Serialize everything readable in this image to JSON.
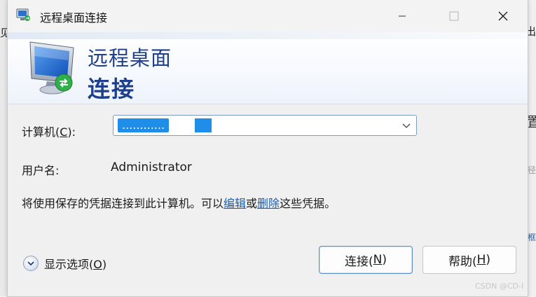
{
  "background": {
    "left_text": "见",
    "right_text_a": "出",
    "right_text_b": "置",
    "right_text_c": "径",
    "right_text_d": "框"
  },
  "window": {
    "title": "远程桌面连接",
    "controls": {
      "minimize_icon": "minimize-icon",
      "maximize_icon": "maximize-icon",
      "close_icon": "close-icon"
    }
  },
  "banner": {
    "line1": "远程桌面",
    "line2": "连接",
    "icon": "remote-desktop-monitor-icon",
    "title_color": "#1e3f8c"
  },
  "form": {
    "computer_label": "计算机(",
    "computer_label_key": "C",
    "computer_label_end": "):",
    "computer_value": "............",
    "user_label": "用户名:",
    "user_value": "Administrator"
  },
  "info": {
    "text_before": "将使用保存的凭据连接到此计算机。可以",
    "link_edit": "编辑",
    "text_middle": "或",
    "link_delete": "删除",
    "text_after": "这些凭据。"
  },
  "footer": {
    "options_label": "显示选项(",
    "options_key": "O",
    "options_end": ")",
    "connect_label": "连接(",
    "connect_key": "N",
    "connect_end": ")",
    "help_label": "帮助(",
    "help_key": "H",
    "help_end": ")"
  },
  "watermark": "CSDN @CD-I",
  "colors": {
    "accent": "#1f8ee8",
    "link": "#1a5fb4",
    "primary_border": "#5b8fd0"
  }
}
